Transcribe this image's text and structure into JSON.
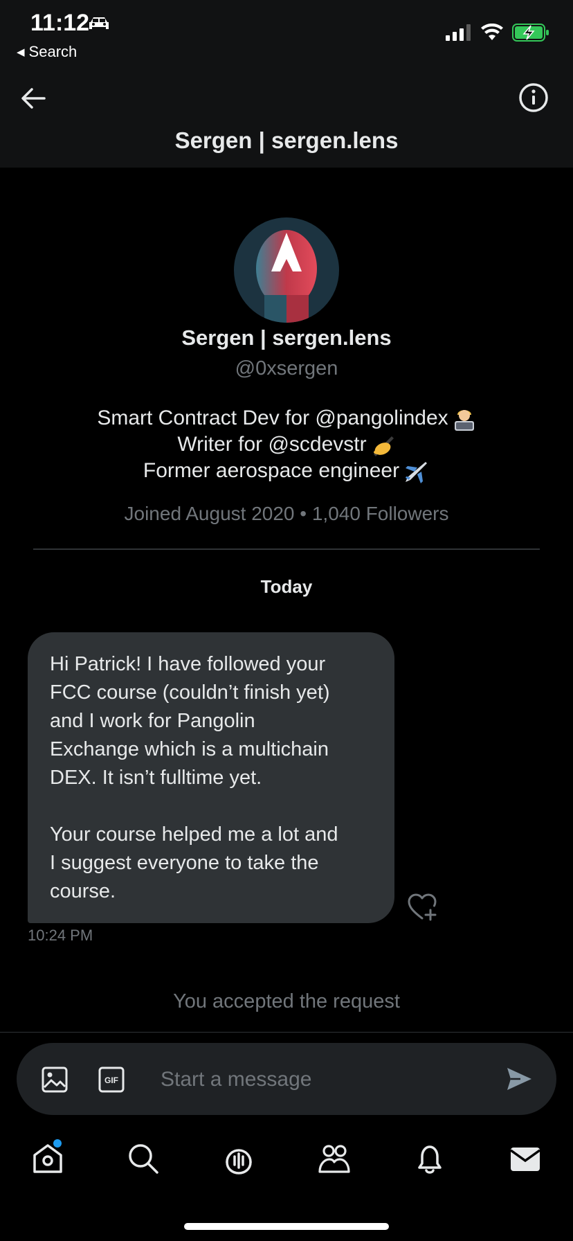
{
  "status_bar": {
    "time": "11:12",
    "back_app": "Search",
    "icons": [
      "car-icon",
      "signal-icon",
      "wifi-icon",
      "battery-charging-icon"
    ]
  },
  "header": {
    "title": "Sergen | sergen.lens",
    "back_icon": "arrow-left-icon",
    "info_icon": "info-icon"
  },
  "profile": {
    "name": "Sergen | sergen.lens",
    "handle": "@0xsergen",
    "bio_lines": [
      "Smart Contract Dev for @pangolindex",
      "Writer for @scdevstr",
      "Former aerospace engineer"
    ],
    "meta": "Joined August 2020 • 1,040 Followers"
  },
  "conversation": {
    "date_label": "Today",
    "messages": [
      {
        "paragraphs": [
          "Hi Patrick! I have followed your\nFCC course (couldn’t finish yet)\nand I work for Pangolin\nExchange which is a multichain\nDEX. It isn’t fulltime yet.",
          "Your course helped me a lot and\nI suggest everyone to take the\ncourse."
        ],
        "time": "10:24 PM"
      }
    ],
    "system_note": "You accepted the request"
  },
  "composer": {
    "placeholder": "Start a message",
    "image_icon": "image-icon",
    "gif_icon": "gif-icon",
    "send_icon": "send-icon"
  },
  "tabbar": {
    "items": [
      "home-icon",
      "search-icon",
      "spaces-icon",
      "communities-icon",
      "notifications-icon",
      "messages-icon"
    ]
  },
  "colors": {
    "background": "#000000",
    "bubble": "#2f3336",
    "muted": "#71767b",
    "accent_dot": "#1d9bf0",
    "battery": "#34c759"
  }
}
